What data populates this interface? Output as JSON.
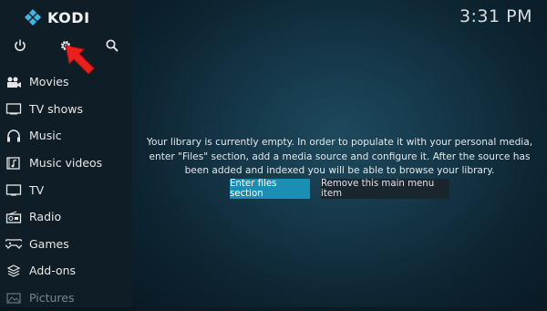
{
  "app": {
    "name": "KODI"
  },
  "clock": "3:31 PM",
  "top_icons": [
    "power-icon",
    "gear-icon",
    "search-icon"
  ],
  "menu": [
    {
      "label": "Movies",
      "icon": "movies-icon"
    },
    {
      "label": "TV shows",
      "icon": "tv-shows-icon"
    },
    {
      "label": "Music",
      "icon": "headphones-icon"
    },
    {
      "label": "Music videos",
      "icon": "music-videos-icon"
    },
    {
      "label": "TV",
      "icon": "tv-icon"
    },
    {
      "label": "Radio",
      "icon": "radio-icon"
    },
    {
      "label": "Games",
      "icon": "gamepad-icon"
    },
    {
      "label": "Add-ons",
      "icon": "addons-icon"
    },
    {
      "label": "Pictures",
      "icon": "pictures-icon"
    }
  ],
  "main": {
    "message": "Your library is currently empty. In order to populate it with your personal media, enter \"Files\" section, add a media source and configure it. After the source has been added and indexed you will be able to browse your library.",
    "primary_button": "Enter files section",
    "secondary_button": "Remove this main menu item"
  },
  "colors": {
    "accent": "#1a8fb3",
    "annotation_arrow": "#e8211d"
  }
}
